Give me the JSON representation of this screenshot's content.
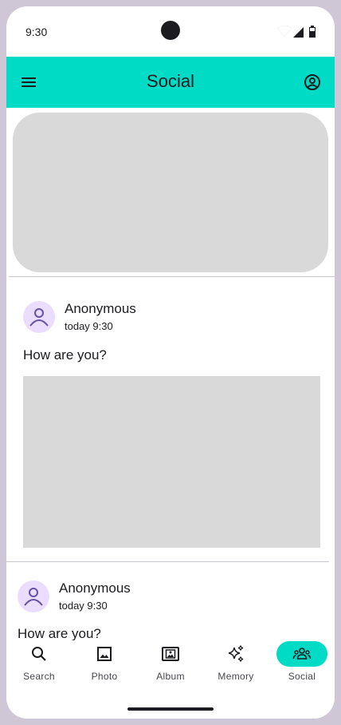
{
  "status_bar": {
    "time": "9:30"
  },
  "app_bar": {
    "title": "Social"
  },
  "posts": [
    {
      "author": "Anonymous",
      "time": "today 9:30",
      "text": "How are you?"
    },
    {
      "author": "Anonymous",
      "time": "today 9:30",
      "text": "How are you?"
    }
  ],
  "nav": {
    "items": [
      {
        "label": "Search",
        "icon": "search-icon"
      },
      {
        "label": "Photo",
        "icon": "image-icon"
      },
      {
        "label": "Album",
        "icon": "album-icon"
      },
      {
        "label": "Memory",
        "icon": "sparkles-icon"
      },
      {
        "label": "Social",
        "icon": "group-icon"
      }
    ],
    "active": "Social"
  },
  "colors": {
    "accent": "#00dbc6",
    "avatar_bg": "#eaddff",
    "avatar_fg": "#6750a4",
    "placeholder": "#d9d9d9",
    "frame": "#cfc6d6"
  }
}
